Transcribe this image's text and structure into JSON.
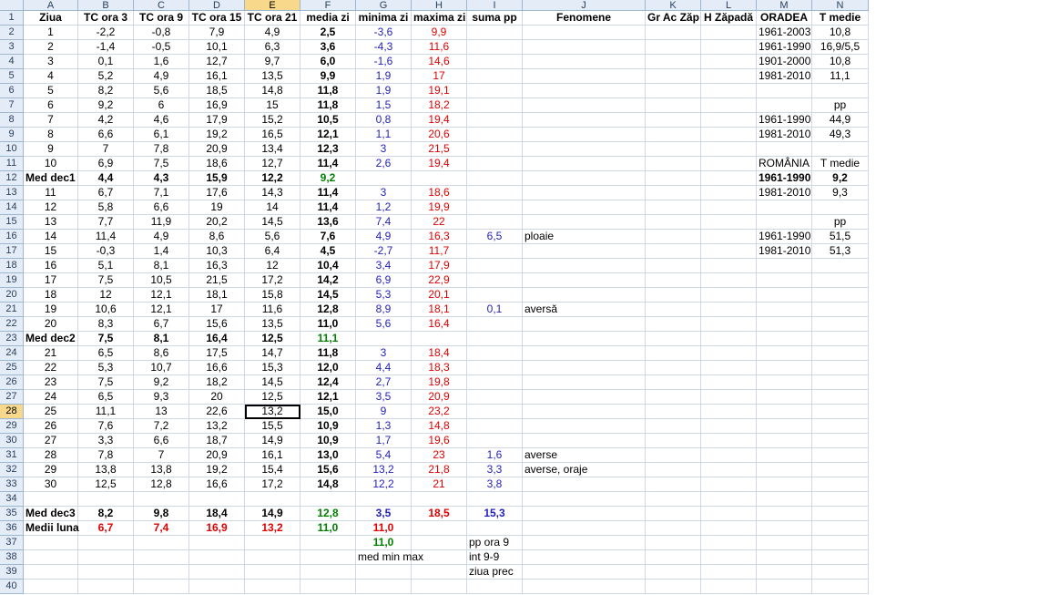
{
  "columns": [
    "A",
    "B",
    "C",
    "D",
    "E",
    "F",
    "G",
    "H",
    "I",
    "J",
    "K",
    "L",
    "M",
    "N"
  ],
  "active_cell": {
    "col": "E",
    "row": 28
  },
  "rows": [
    {
      "n": 1,
      "cells": {
        "A": "Ziua",
        "B": "TC ora 3",
        "C": "TC ora 9",
        "D": "TC ora 15",
        "E": "TC ora 21",
        "F": "media zi",
        "G": "minima zi",
        "H": "maxima zi",
        "I": "suma pp",
        "J": "Fenomene",
        "K": "Gr Ac Zăp",
        "L": "H Zăpadă",
        "M": "ORADEA",
        "N": "T medie"
      }
    },
    {
      "n": 2,
      "cells": {
        "A": "1",
        "B": "-2,2",
        "C": "-0,8",
        "D": "7,9",
        "E": "4,9",
        "F": "2,5",
        "G": "-3,6",
        "H": "9,9",
        "M": "1961-2003",
        "N": "10,8"
      }
    },
    {
      "n": 3,
      "cells": {
        "A": "2",
        "B": "-1,4",
        "C": "-0,5",
        "D": "10,1",
        "E": "6,3",
        "F": "3,6",
        "G": "-4,3",
        "H": "11,6",
        "M": "1961-1990",
        "N": "16,9/5,5"
      }
    },
    {
      "n": 4,
      "cells": {
        "A": "3",
        "B": "0,1",
        "C": "1,6",
        "D": "12,7",
        "E": "9,7",
        "F": "6,0",
        "G": "-1,6",
        "H": "14,6",
        "M": "1901-2000",
        "N": "10,8"
      }
    },
    {
      "n": 5,
      "cells": {
        "A": "4",
        "B": "5,2",
        "C": "4,9",
        "D": "16,1",
        "E": "13,5",
        "F": "9,9",
        "G": "1,9",
        "H": "17",
        "M": "1981-2010",
        "N": "11,1"
      }
    },
    {
      "n": 6,
      "cells": {
        "A": "5",
        "B": "8,2",
        "C": "5,6",
        "D": "18,5",
        "E": "14,8",
        "F": "11,8",
        "G": "1,9",
        "H": "19,1"
      }
    },
    {
      "n": 7,
      "cells": {
        "A": "6",
        "B": "9,2",
        "C": "6",
        "D": "16,9",
        "E": "15",
        "F": "11,8",
        "G": "1,5",
        "H": "18,2",
        "N": "pp"
      }
    },
    {
      "n": 8,
      "cells": {
        "A": "7",
        "B": "4,2",
        "C": "4,6",
        "D": "17,9",
        "E": "15,2",
        "F": "10,5",
        "G": "0,8",
        "H": "19,4",
        "M": "1961-1990",
        "N": "44,9"
      }
    },
    {
      "n": 9,
      "cells": {
        "A": "8",
        "B": "6,6",
        "C": "6,1",
        "D": "19,2",
        "E": "16,5",
        "F": "12,1",
        "G": "1,1",
        "H": "20,6",
        "M": "1981-2010",
        "N": "49,3"
      }
    },
    {
      "n": 10,
      "cells": {
        "A": "9",
        "B": "7",
        "C": "7,8",
        "D": "20,9",
        "E": "13,4",
        "F": "12,3",
        "G": "3",
        "H": "21,5"
      }
    },
    {
      "n": 11,
      "cells": {
        "A": "10",
        "B": "6,9",
        "C": "7,5",
        "D": "18,6",
        "E": "12,7",
        "F": "11,4",
        "G": "2,6",
        "H": "19,4",
        "M": "ROMÂNIA",
        "N": "T medie"
      }
    },
    {
      "n": 12,
      "cells": {
        "A": "Med dec1",
        "B": "4,4",
        "C": "4,3",
        "D": "15,9",
        "E": "12,2",
        "F": "9,2",
        "M": "1961-1990",
        "N": "9,2"
      }
    },
    {
      "n": 13,
      "cells": {
        "A": "11",
        "B": "6,7",
        "C": "7,1",
        "D": "17,6",
        "E": "14,3",
        "F": "11,4",
        "G": "3",
        "H": "18,6",
        "M": "1981-2010",
        "N": "9,3"
      }
    },
    {
      "n": 14,
      "cells": {
        "A": "12",
        "B": "5,8",
        "C": "6,6",
        "D": "19",
        "E": "14",
        "F": "11,4",
        "G": "1,2",
        "H": "19,9"
      }
    },
    {
      "n": 15,
      "cells": {
        "A": "13",
        "B": "7,7",
        "C": "11,9",
        "D": "20,2",
        "E": "14,5",
        "F": "13,6",
        "G": "7,4",
        "H": "22",
        "N": "pp"
      }
    },
    {
      "n": 16,
      "cells": {
        "A": "14",
        "B": "11,4",
        "C": "4,9",
        "D": "8,6",
        "E": "5,6",
        "F": "7,6",
        "G": "4,9",
        "H": "16,3",
        "I": "6,5",
        "J": "ploaie",
        "M": "1961-1990",
        "N": "51,5"
      }
    },
    {
      "n": 17,
      "cells": {
        "A": "15",
        "B": "-0,3",
        "C": "1,4",
        "D": "10,3",
        "E": "6,4",
        "F": "4,5",
        "G": "-2,7",
        "H": "11,7",
        "M": "1981-2010",
        "N": "51,3"
      }
    },
    {
      "n": 18,
      "cells": {
        "A": "16",
        "B": "5,1",
        "C": "8,1",
        "D": "16,3",
        "E": "12",
        "F": "10,4",
        "G": "3,4",
        "H": "17,9"
      }
    },
    {
      "n": 19,
      "cells": {
        "A": "17",
        "B": "7,5",
        "C": "10,5",
        "D": "21,5",
        "E": "17,2",
        "F": "14,2",
        "G": "6,9",
        "H": "22,9"
      }
    },
    {
      "n": 20,
      "cells": {
        "A": "18",
        "B": "12",
        "C": "12,1",
        "D": "18,1",
        "E": "15,8",
        "F": "14,5",
        "G": "5,3",
        "H": "20,1"
      }
    },
    {
      "n": 21,
      "cells": {
        "A": "19",
        "B": "10,6",
        "C": "12,1",
        "D": "17",
        "E": "11,6",
        "F": "12,8",
        "G": "8,9",
        "H": "18,1",
        "I": "0,1",
        "J": "aversă"
      }
    },
    {
      "n": 22,
      "cells": {
        "A": "20",
        "B": "8,3",
        "C": "6,7",
        "D": "15,6",
        "E": "13,5",
        "F": "11,0",
        "G": "5,6",
        "H": "16,4"
      }
    },
    {
      "n": 23,
      "cells": {
        "A": "Med dec2",
        "B": "7,5",
        "C": "8,1",
        "D": "16,4",
        "E": "12,5",
        "F": "11,1"
      }
    },
    {
      "n": 24,
      "cells": {
        "A": "21",
        "B": "6,5",
        "C": "8,6",
        "D": "17,5",
        "E": "14,7",
        "F": "11,8",
        "G": "3",
        "H": "18,4"
      }
    },
    {
      "n": 25,
      "cells": {
        "A": "22",
        "B": "5,3",
        "C": "10,7",
        "D": "16,6",
        "E": "15,3",
        "F": "12,0",
        "G": "4,4",
        "H": "18,3"
      }
    },
    {
      "n": 26,
      "cells": {
        "A": "23",
        "B": "7,5",
        "C": "9,2",
        "D": "18,2",
        "E": "14,5",
        "F": "12,4",
        "G": "2,7",
        "H": "19,8"
      }
    },
    {
      "n": 27,
      "cells": {
        "A": "24",
        "B": "6,5",
        "C": "9,3",
        "D": "20",
        "E": "12,5",
        "F": "12,1",
        "G": "3,5",
        "H": "20,9"
      }
    },
    {
      "n": 28,
      "cells": {
        "A": "25",
        "B": "11,1",
        "C": "13",
        "D": "22,6",
        "E": "13,2",
        "F": "15,0",
        "G": "9",
        "H": "23,2"
      }
    },
    {
      "n": 29,
      "cells": {
        "A": "26",
        "B": "7,6",
        "C": "7,2",
        "D": "13,2",
        "E": "15,5",
        "F": "10,9",
        "G": "1,3",
        "H": "14,8"
      }
    },
    {
      "n": 30,
      "cells": {
        "A": "27",
        "B": "3,3",
        "C": "6,6",
        "D": "18,7",
        "E": "14,9",
        "F": "10,9",
        "G": "1,7",
        "H": "19,6"
      }
    },
    {
      "n": 31,
      "cells": {
        "A": "28",
        "B": "7,8",
        "C": "7",
        "D": "20,9",
        "E": "16,1",
        "F": "13,0",
        "G": "5,4",
        "H": "23",
        "I": "1,6",
        "J": "averse"
      }
    },
    {
      "n": 32,
      "cells": {
        "A": "29",
        "B": "13,8",
        "C": "13,8",
        "D": "19,2",
        "E": "15,4",
        "F": "15,6",
        "G": "13,2",
        "H": "21,8",
        "I": "3,3",
        "J": "averse, oraje"
      }
    },
    {
      "n": 33,
      "cells": {
        "A": "30",
        "B": "12,5",
        "C": "12,8",
        "D": "16,6",
        "E": "17,2",
        "F": "14,8",
        "G": "12,2",
        "H": "21",
        "I": "3,8"
      }
    },
    {
      "n": 34,
      "cells": {}
    },
    {
      "n": 35,
      "cells": {
        "A": "Med dec3",
        "B": "8,2",
        "C": "9,8",
        "D": "18,4",
        "E": "14,9",
        "F": "12,8",
        "G": "3,5",
        "H": "18,5",
        "I": "15,3"
      }
    },
    {
      "n": 36,
      "cells": {
        "A": "Medii luna",
        "B": "6,7",
        "C": "7,4",
        "D": "16,9",
        "E": "13,2",
        "F": "11,0",
        "G": "11,0"
      }
    },
    {
      "n": 37,
      "cells": {
        "G": "11,0",
        "I": "pp ora 9"
      }
    },
    {
      "n": 38,
      "cells": {
        "G": "med min max",
        "I": "int 9-9"
      }
    },
    {
      "n": 39,
      "cells": {
        "I": "ziua prec"
      }
    },
    {
      "n": 40,
      "cells": {}
    }
  ]
}
